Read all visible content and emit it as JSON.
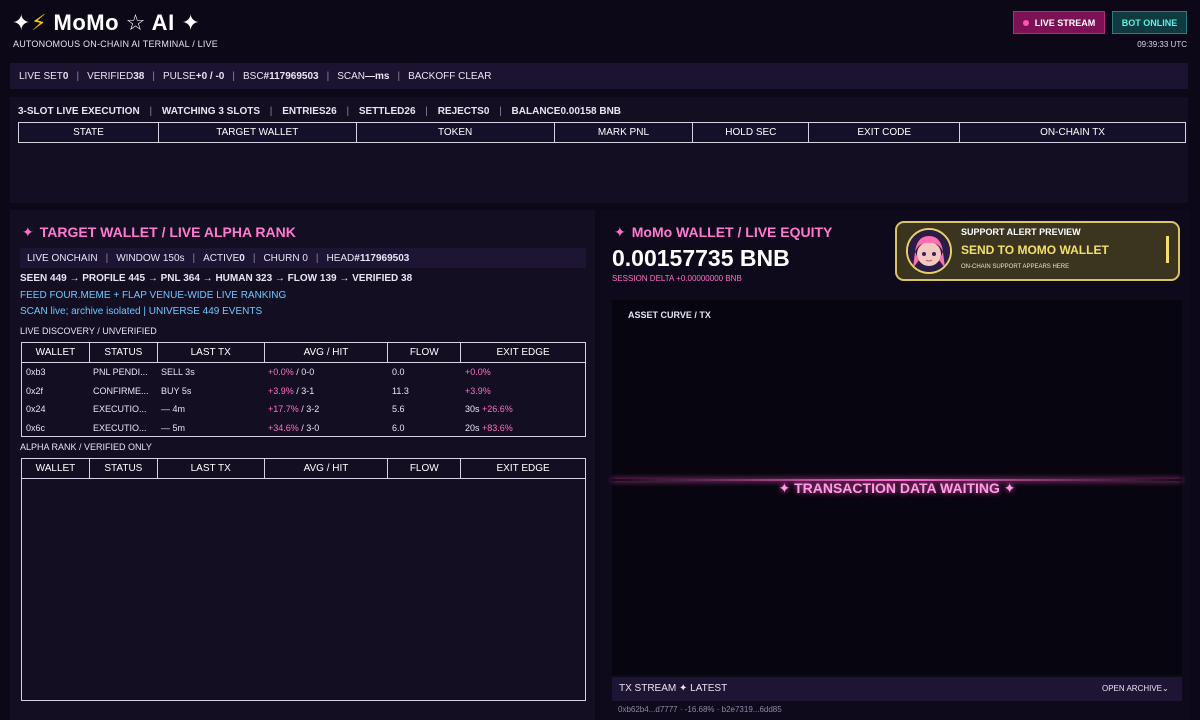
{
  "header": {
    "title": "MoMo ☆ AI",
    "subtitle": "AUTONOMOUS ON-CHAIN AI TERMINAL / LIVE",
    "live_stream_label": "LIVE STREAM",
    "bot_status_label": "BOT ONLINE",
    "clock": "09:39:33 UTC"
  },
  "status": {
    "live_set_label": "LIVE SET",
    "live_set": "0",
    "verified_label": "VERIFIED",
    "verified": "38",
    "pulse_label": "PULSE",
    "pulse": "+0 / -0",
    "bsc_label": "BSC",
    "bsc": "#117969503",
    "scan_label": "SCAN",
    "scan": "—ms",
    "backoff": "BACKOFF CLEAR"
  },
  "execution": {
    "title": "3-SLOT LIVE EXECUTION",
    "watching": "WATCHING 3 SLOTS",
    "entries_label": "ENTRIES",
    "entries": "26",
    "settled_label": "SETTLED",
    "settled": "26",
    "rejects_label": "REJECTS",
    "rejects": "0",
    "balance_label": "BALANCE",
    "balance": "0.00158 BNB",
    "columns": [
      "STATE",
      "TARGET WALLET",
      "TOKEN",
      "MARK PNL",
      "HOLD SEC",
      "EXIT CODE",
      "ON-CHAIN TX"
    ]
  },
  "alpha_panel": {
    "title": "TARGET WALLET / LIVE ALPHA RANK",
    "strip": {
      "live": "LIVE ONCHAIN",
      "window": "WINDOW 150s",
      "active_label": "ACTIVE",
      "active": "0",
      "churn": "CHURN 0",
      "head_label": "HEAD",
      "head": "#117969503"
    },
    "funnel": "SEEN 449 → PROFILE 445 → PNL 364 → HUMAN 323 → FLOW 139 → VERIFIED 38",
    "feed": "FEED FOUR.MEME + FLAP VENUE-WIDE LIVE RANKING",
    "scan_line": "SCAN live; archive isolated | UNIVERSE 449 EVENTS",
    "discovery_label": "LIVE DISCOVERY  /  UNVERIFIED",
    "alpha_label": "ALPHA RANK  /  VERIFIED ONLY",
    "columns": [
      "WALLET",
      "STATUS",
      "LAST TX",
      "AVG / HIT",
      "FLOW",
      "EXIT EDGE"
    ],
    "discovery_rows": [
      {
        "wallet": "0xb3",
        "status": "PNL PENDI...",
        "last_tx": "SELL 3s",
        "avg": "+0.0%",
        "hit": " / 0-0",
        "flow": "0.0",
        "exit_time": "",
        "exit_edge": "+0.0%"
      },
      {
        "wallet": "0x2f",
        "status": "CONFIRME...",
        "last_tx": "BUY 5s",
        "avg": "+3.9%",
        "hit": " / 3-1",
        "flow": "11.3",
        "exit_time": "",
        "exit_edge": "+3.9%"
      },
      {
        "wallet": "0x24",
        "status": "EXECUTIO...",
        "last_tx": "— 4m",
        "avg": "+17.7%",
        "hit": " / 3-2",
        "flow": "5.6",
        "exit_time": "30s ",
        "exit_edge": "+26.6%"
      },
      {
        "wallet": "0x6c",
        "status": "EXECUTIO...",
        "last_tx": "— 5m",
        "avg": "+34.6%",
        "hit": " / 3-0",
        "flow": "6.0",
        "exit_time": "20s ",
        "exit_edge": "+83.6%"
      }
    ]
  },
  "wallet_panel": {
    "title": "MoMo WALLET / LIVE EQUITY",
    "equity": "0.00157735 BNB",
    "delta": "SESSION DELTA +0.00000000 BNB",
    "alert": {
      "preview": "SUPPORT ALERT PREVIEW",
      "headline": "SEND TO MOMO WALLET",
      "note": "ON-CHAIN SUPPORT APPEARS HERE"
    },
    "curve_label": "ASSET CURVE / TX",
    "waiting": "✦ TRANSACTION DATA WAITING ✦",
    "tx_stream_label": "TX STREAM  ✦  LATEST",
    "open_archive": "OPEN ARCHIVE⌄",
    "tx_first": "0xb62b4...d7777 · -16.68% · b2e7319...6dd85"
  }
}
